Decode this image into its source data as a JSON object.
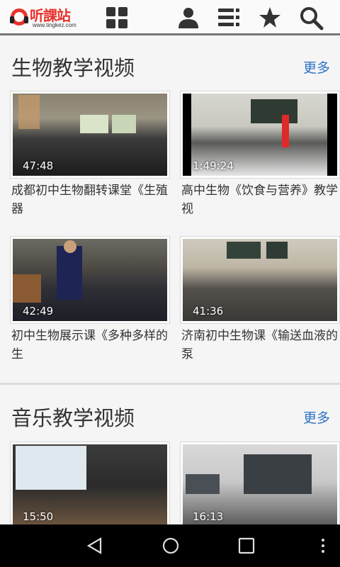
{
  "header": {
    "brand": "听課站",
    "url": "www.tingkez.com",
    "icons": [
      "grid-icon",
      "user-icon",
      "list-icon",
      "star-icon",
      "search-icon"
    ]
  },
  "sections": [
    {
      "title": "生物教学视频",
      "more": "更多",
      "videos": [
        {
          "duration": "47:48",
          "caption": "成都初中生物翻转课堂《生殖器"
        },
        {
          "duration": "1:49:24",
          "caption": "高中生物《饮食与营养》教学视"
        },
        {
          "duration": "42:49",
          "caption": "初中生物展示课《多种多样的生"
        },
        {
          "duration": "41:36",
          "caption": "济南初中生物课《输送血液的泵"
        }
      ]
    },
    {
      "title": "音乐教学视频",
      "more": "更多",
      "videos": [
        {
          "duration": "15:50",
          "caption": ""
        },
        {
          "duration": "16:13",
          "caption": ""
        }
      ]
    }
  ],
  "colors": {
    "brand": "#e8312a",
    "link": "#2b73c6"
  }
}
